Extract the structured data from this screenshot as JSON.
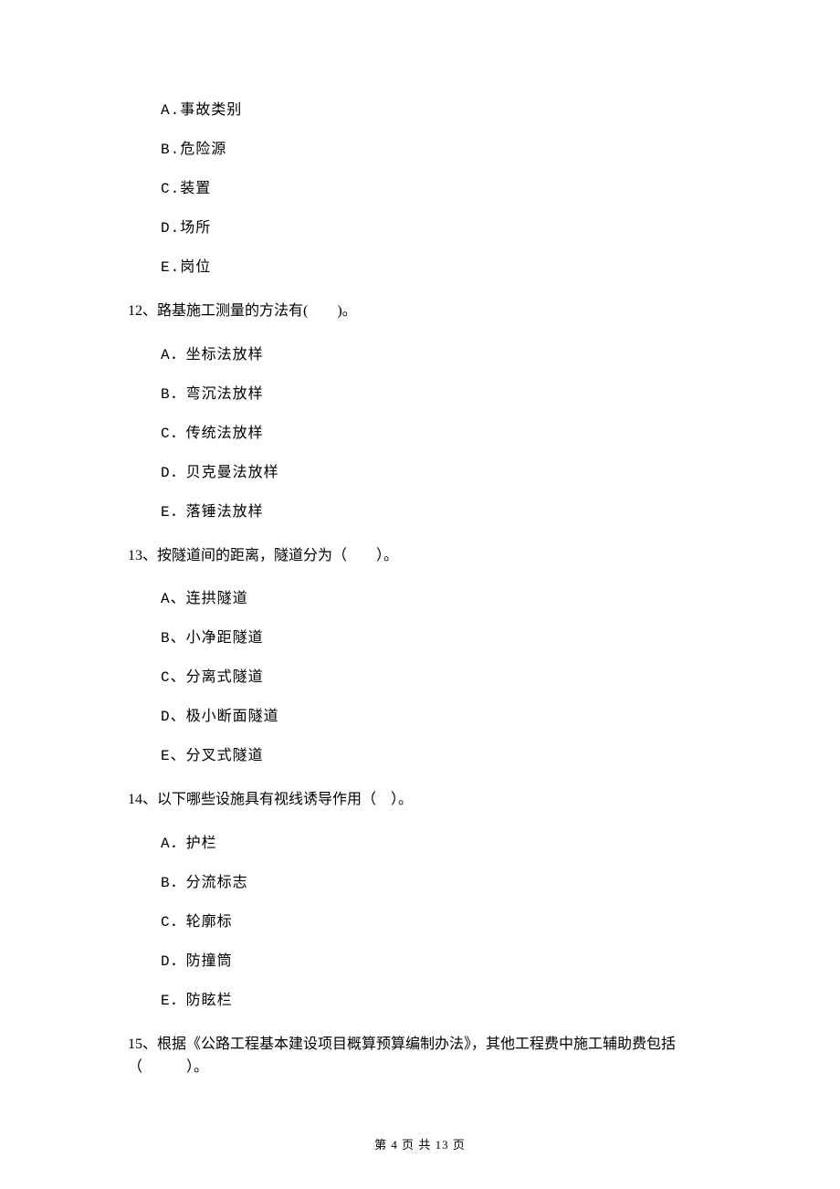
{
  "q11_opts": {
    "a": "A.事故类别",
    "b": "B.危险源",
    "c": "C.装置",
    "d": "D.场所",
    "e": "E.岗位"
  },
  "q12": {
    "stem": "12、路基施工测量的方法有(　　)。",
    "a": "A．坐标法放样",
    "b": "B．弯沉法放样",
    "c": "C．传统法放样",
    "d": "D．贝克曼法放样",
    "e": "E．落锤法放样"
  },
  "q13": {
    "stem": "13、按隧道间的距离，隧道分为（　　）。",
    "a": "A、连拱隧道",
    "b": "B、小净距隧道",
    "c": "C、分离式隧道",
    "d": "D、极小断面隧道",
    "e": "E、分叉式隧道"
  },
  "q14": {
    "stem": "14、以下哪些设施具有视线诱导作用（　）。",
    "a": "A．护栏",
    "b": "B．分流标志",
    "c": "C．轮廓标",
    "d": "D．防撞筒",
    "e": "E．防眩栏"
  },
  "q15": {
    "stem": "15、根据《公路工程基本建设项目概算预算编制办法》，其他工程费中施工辅助费包括（　　　）。"
  },
  "footer": "第 4 页 共 13 页"
}
